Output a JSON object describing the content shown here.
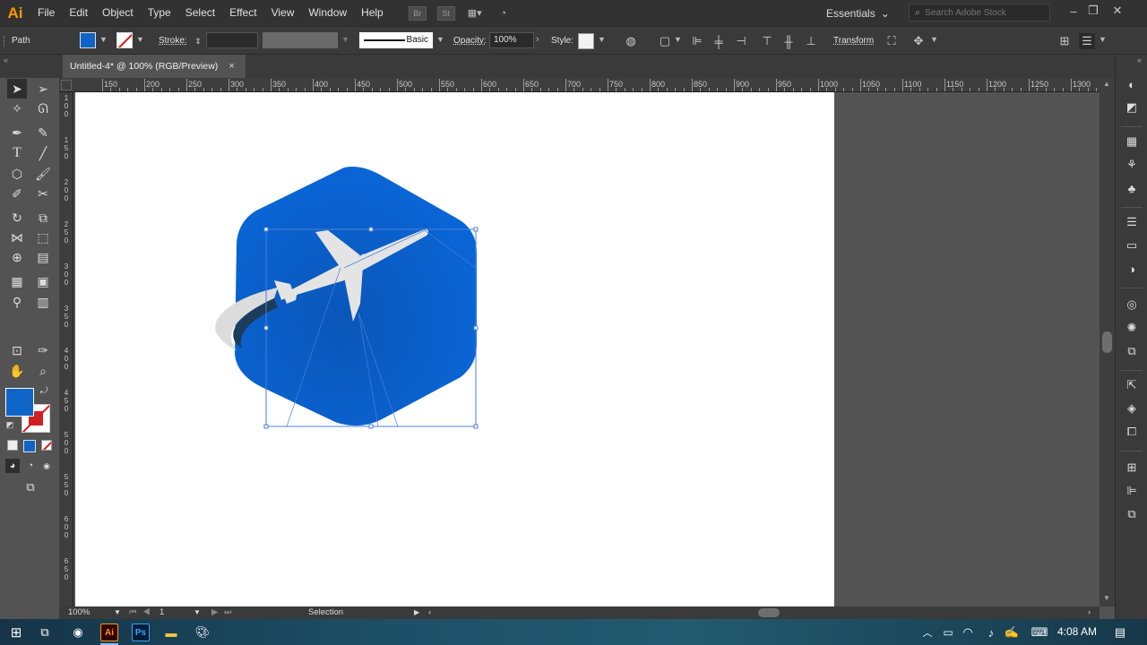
{
  "app": {
    "logo": "Ai",
    "accent": "#ff9a00"
  },
  "menubar": {
    "items": [
      "File",
      "Edit",
      "Object",
      "Type",
      "Select",
      "Effect",
      "View",
      "Window",
      "Help"
    ],
    "bridge_icon": "Br",
    "stock_icon": "St",
    "workspace": "Essentials",
    "search_placeholder": "Search Adobe Stock"
  },
  "control": {
    "object_type": "Path",
    "stroke_label": "Stroke:",
    "brush_label": "Basic",
    "opacity_label": "Opacity:",
    "opacity_value": "100%",
    "style_label": "Style:",
    "transform_label": "Transform",
    "fill_color": "#0f64c8"
  },
  "document": {
    "tab_title": "Untitled-4* @ 100% (RGB/Preview)",
    "close_icon": "×"
  },
  "ruler": {
    "h_labels": [
      "150",
      "200",
      "250",
      "300",
      "350",
      "400",
      "450",
      "500",
      "550",
      "600",
      "650",
      "700",
      "750",
      "800",
      "850",
      "900",
      "950",
      "1000",
      "1050",
      "1100",
      "1150",
      "1200",
      "1250",
      "1300"
    ],
    "v_labels": [
      "100",
      "150",
      "200",
      "250",
      "300",
      "350",
      "400",
      "450",
      "500",
      "550",
      "600",
      "650"
    ]
  },
  "artwork": {
    "hexagon_color": "#0a5fcc",
    "plane_color": "#e4e4e4",
    "swoosh_dark": "#1d3c5a",
    "selection_color": "#4a7fd8"
  },
  "status": {
    "zoom": "100%",
    "artboard_number": "1",
    "tool": "Selection"
  },
  "taskbar": {
    "ai_label": "Ai",
    "ps_label": "Ps",
    "time": "4:08 AM"
  }
}
